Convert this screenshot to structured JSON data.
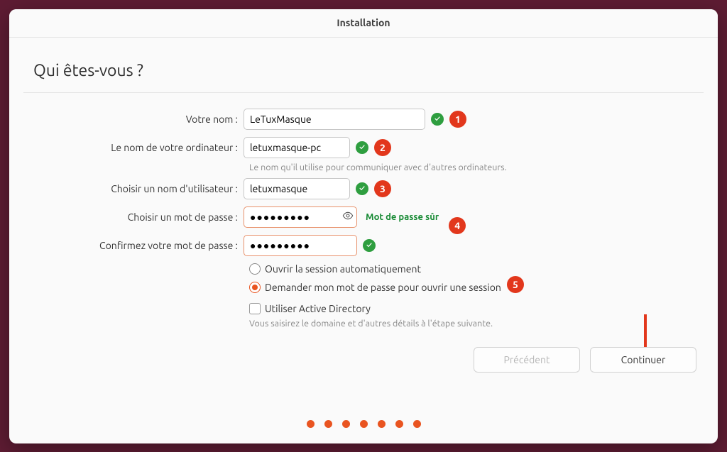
{
  "window": {
    "title": "Installation"
  },
  "heading": "Qui êtes-vous ?",
  "labels": {
    "name": "Votre nom :",
    "hostname": "Le nom de votre ordinateur :",
    "username": "Choisir un nom d'utilisateur :",
    "password": "Choisir un mot de passe :",
    "confirm": "Confirmez votre mot de passe :"
  },
  "fields": {
    "name": "LeTuxMasque",
    "hostname": "letuxmasque-pc",
    "username": "letuxmasque",
    "password": "●●●●●●●●●",
    "confirm": "●●●●●●●●●"
  },
  "hostname_helper": "Le nom qu'il utilise pour communiquer avec d'autres ordinateurs.",
  "password_strength": "Mot de passe sûr",
  "radios": {
    "auto_login": "Ouvrir la session automatiquement",
    "require_pw": "Demander mon mot de passe pour ouvrir une session"
  },
  "active_directory": {
    "label": "Utiliser Active Directory",
    "helper": "Vous saisirez le domaine et d'autres détails à l'étape suivante."
  },
  "buttons": {
    "back": "Précédent",
    "continue": "Continuer"
  },
  "annotations": {
    "b1": "1",
    "b2": "2",
    "b3": "3",
    "b4": "4",
    "b5": "5"
  }
}
